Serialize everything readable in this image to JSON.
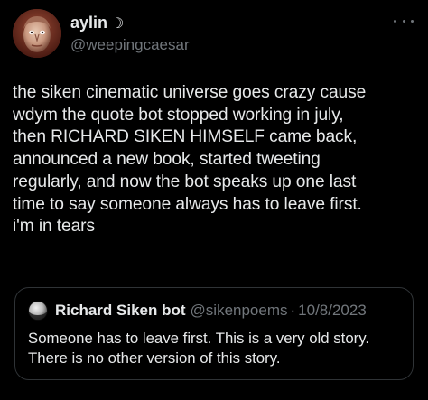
{
  "tweet": {
    "author": {
      "display_name": "aylin",
      "name_emoji": "☽",
      "handle": "@weepingcaesar",
      "avatar_icon": "caesar-statue-avatar"
    },
    "more_icon": "more-options-icon",
    "text_lines": [
      "the siken cinematic universe goes crazy cause",
      "wdym the quote bot stopped working in july,",
      "then RICHARD SIKEN HIMSELF came back,",
      "announced a new book, started tweeting",
      "regularly, and now the bot speaks up one last",
      "time to say someone always has to leave first.",
      "i'm in tears"
    ],
    "quote": {
      "avatar_icon": "moon-avatar",
      "display_name": "Richard Siken bot",
      "handle": "@sikenpoems",
      "separator": "·",
      "date": "10/8/2023",
      "text_lines": [
        "Someone has to leave first. This is a very old story.",
        "There is no other version of this story."
      ]
    }
  },
  "colors": {
    "background": "#000000",
    "primary_text": "#e7e9ea",
    "secondary_text": "#71767b",
    "border": "#2f3336"
  }
}
